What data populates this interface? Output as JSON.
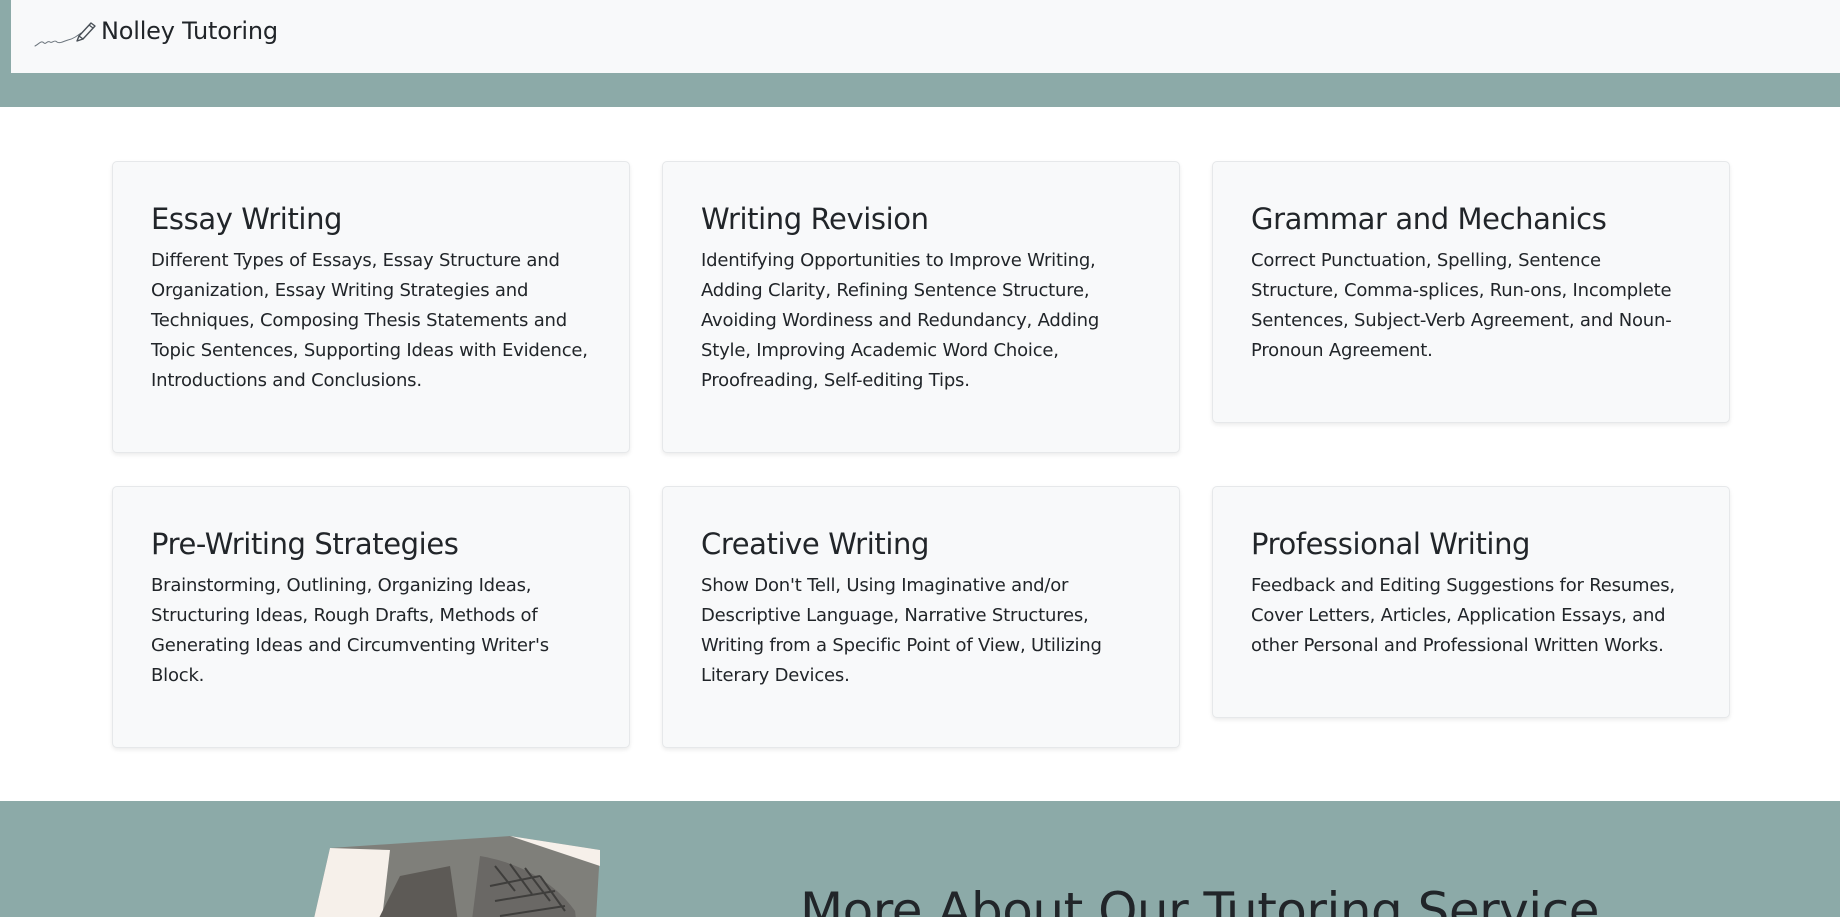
{
  "brand": {
    "name": "Nolley Tutoring",
    "logo_icon": "pen-signature-icon"
  },
  "colors": {
    "accent": "#8caaa8",
    "card_bg": "#f8f9fa",
    "text": "#212529"
  },
  "services": [
    {
      "title": "Essay Writing",
      "description": "Different Types of Essays, Essay Structure and Organization, Essay Writing Strategies and Techniques, Composing Thesis Statements and Topic Sentences, Supporting Ideas with Evidence, Introductions and Conclusions."
    },
    {
      "title": "Writing Revision",
      "description": "Identifying Opportunities to Improve Writing, Adding Clarity, Refining Sentence Structure, Avoiding Wordiness and Redundancy, Adding Style, Improving Academic Word Choice, Proofreading, Self-editing Tips."
    },
    {
      "title": "Grammar and Mechanics",
      "description": "Correct Punctuation, Spelling, Sentence Structure, Comma-splices, Run-ons, Incomplete Sentences, Subject-Verb Agreement, and Noun-Pronoun Agreement."
    },
    {
      "title": "Pre-Writing Strategies",
      "description": "Brainstorming, Outlining, Organizing Ideas, Structuring Ideas, Rough Drafts, Methods of Generating Ideas and Circumventing Writer's Block."
    },
    {
      "title": "Creative Writing",
      "description": "Show Don't Tell, Using Imaginative and/or Descriptive Language, Narrative Structures, Writing from a Specific Point of View, Utilizing Literary Devices."
    },
    {
      "title": "Professional Writing",
      "description": "Feedback and Editing Suggestions for Resumes, Cover Letters, Articles, Application Essays, and other Personal and Professional Written Works."
    }
  ],
  "about": {
    "title": "More About Our Tutoring Service"
  }
}
